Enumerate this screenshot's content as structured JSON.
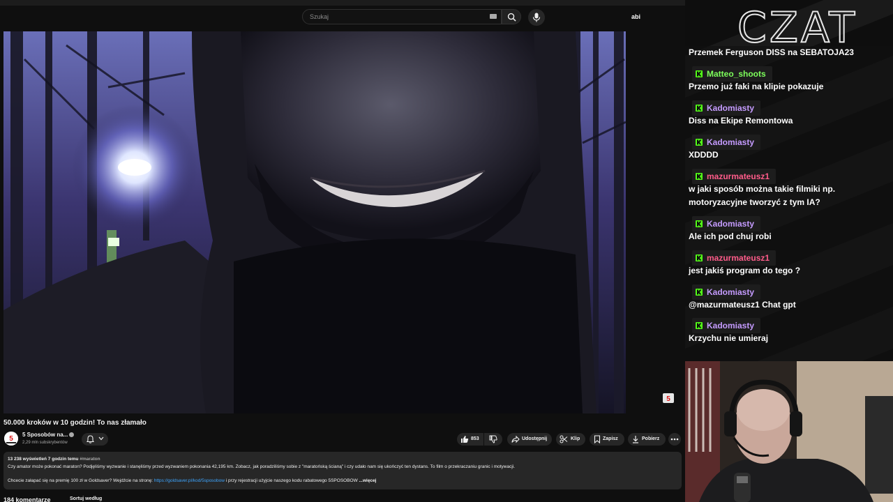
{
  "youtube": {
    "search": {
      "placeholder": "Szukaj"
    },
    "user": "abi",
    "video": {
      "title": "50.000 kroków w 10 godzin! To nas złamało"
    },
    "channel": {
      "name": "5 Sposobów na...",
      "subscribers": "2,29 mln subskrybentów"
    },
    "actions": {
      "likes": "853",
      "share": "Udostępnij",
      "clip": "Klip",
      "save": "Zapisz",
      "download": "Pobierz"
    },
    "description": {
      "stats": "13 238 wyświetleń  7 godzin temu",
      "hashtag": "#maraton",
      "line1": "Czy amator może pokonać maraton? Podjęliśmy wyzwanie i stanęliśmy przed wyzwaniem pokonania 42,195 km. Zobacz, jak poradziliśmy sobie z \"maratońską ścianą\" i czy udało nam się ukończyć ten dystans. To film o przekraczaniu granic i motywacji.",
      "line2_prefix": "Chcecie załapać się na premię 100 zł w Goldsaver? Wejdźcie na stronę: ",
      "line2_link": "https://goldsaver.pl/kod/5sposobow",
      "line2_suffix": " i przy rejestracji użyjcie naszego kodu rabatowego 5SPOSOBOW",
      "more": " ...więcej"
    },
    "comments": {
      "count": "184 komentarze",
      "sort": "Sortuj według"
    }
  },
  "chat": {
    "logo": "CZAT",
    "colors": {
      "green": "#53fc18",
      "pink": "#ff5c8a",
      "purple": "#c59bff"
    },
    "messages": [
      {
        "user": "",
        "text": "Przemek Ferguson DISS na SEBATOJA23"
      },
      {
        "user": "Matteo_shoots",
        "user_color": "#7dff5b",
        "text": "Przemo już faki na klipie pokazuje"
      },
      {
        "user": "Kadomiasty",
        "user_color": "#c59bff",
        "text": "Diss na Ekipe Remontowa"
      },
      {
        "user": "Kadomiasty",
        "user_color": "#c59bff",
        "text": "XDDDD"
      },
      {
        "user": "mazurmateusz1",
        "user_color": "#ff5c8a",
        "text": "w jaki sposób można takie filmiki np.",
        "text2": "motoryzacyjne tworzyć z tym IA?"
      },
      {
        "user": "Kadomiasty",
        "user_color": "#c59bff",
        "text": "Ale ich pod chuj robi"
      },
      {
        "user": "mazurmateusz1",
        "user_color": "#ff5c8a",
        "text": "jest jakiś program do tego ?"
      },
      {
        "user": "Kadomiasty",
        "user_color": "#c59bff",
        "text": "@mazurmateusz1 Chat gpt"
      },
      {
        "user": "Kadomiasty",
        "user_color": "#c59bff",
        "text": "Krzychu nie umieraj"
      }
    ]
  }
}
